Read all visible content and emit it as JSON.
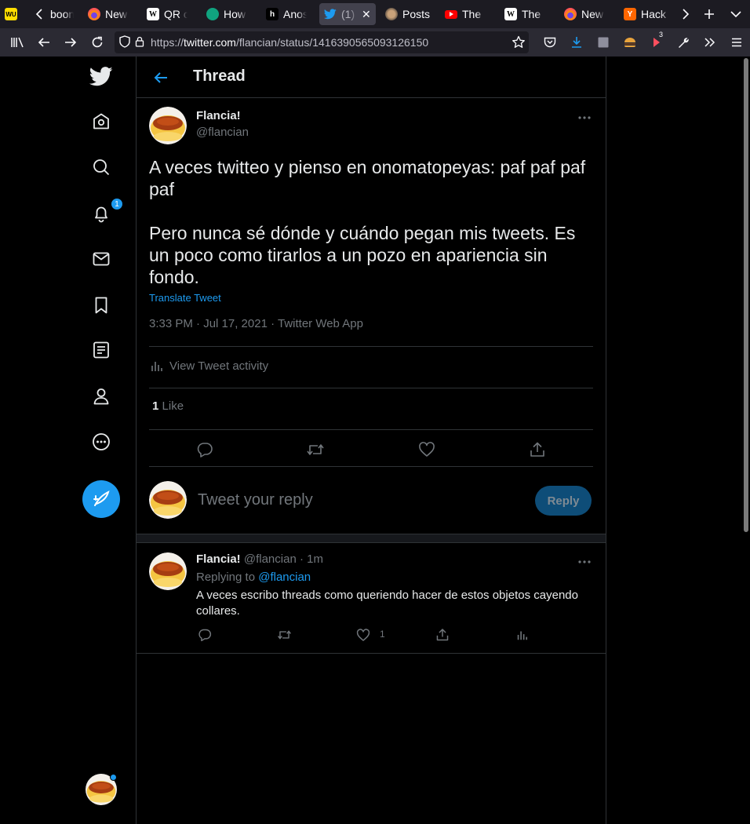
{
  "browser": {
    "tabs": [
      {
        "label": "",
        "favicon": "wu-icon",
        "active": false
      },
      {
        "label": "boon",
        "favicon": "",
        "active": false
      },
      {
        "label": "New",
        "favicon": "firefox-icon",
        "active": false
      },
      {
        "label": "QR c",
        "favicon": "wikipedia-icon",
        "active": false
      },
      {
        "label": "How",
        "favicon": "robot-icon",
        "active": false
      },
      {
        "label": "Anos",
        "favicon": "h-icon",
        "active": false
      },
      {
        "label": "(1)",
        "favicon": "twitter-icon",
        "active": true
      },
      {
        "label": "Posts",
        "favicon": "avatar-icon",
        "active": false
      },
      {
        "label": "The",
        "favicon": "youtube-icon",
        "active": false
      },
      {
        "label": "The",
        "favicon": "wikipedia-icon",
        "active": false
      },
      {
        "label": "New",
        "favicon": "firefox-icon",
        "active": false
      },
      {
        "label": "Hack",
        "favicon": "ycombinator-icon",
        "active": false
      }
    ],
    "url_prefix": "https://",
    "url_host": "twitter.com",
    "url_path": "/flancian/status/1416390565093126150",
    "extension_badge": "3"
  },
  "nav": {
    "notification_count": "1"
  },
  "header": {
    "title": "Thread"
  },
  "main_tweet": {
    "name": "Flancia!",
    "handle": "@flancian",
    "text": "A veces twitteo y pienso en onomatopeyas: paf paf paf paf\n\nPero nunca sé dónde y cuándo pegan mis tweets. Es un poco como tirarlos a un pozo en apariencia sin fondo.",
    "translate_label": "Translate Tweet",
    "meta": "3:33 PM · Jul 17, 2021 · Twitter Web App",
    "activity_label": "View Tweet activity",
    "like_count": "1",
    "like_label": "Like"
  },
  "reply_box": {
    "placeholder": "Tweet your reply",
    "button_label": "Reply"
  },
  "reply_tweet": {
    "name": "Flancia!",
    "handle_time": "@flancian · 1m",
    "replying_prefix": "Replying to",
    "replying_to": "@flancian",
    "text": "A veces escribo threads como queriendo hacer de estos objetos cayendo collares.",
    "like_count": "1"
  },
  "colors": {
    "accent": "#1d9bf0",
    "background": "#000000",
    "border": "#2f3336",
    "secondary_text": "#71767b"
  }
}
